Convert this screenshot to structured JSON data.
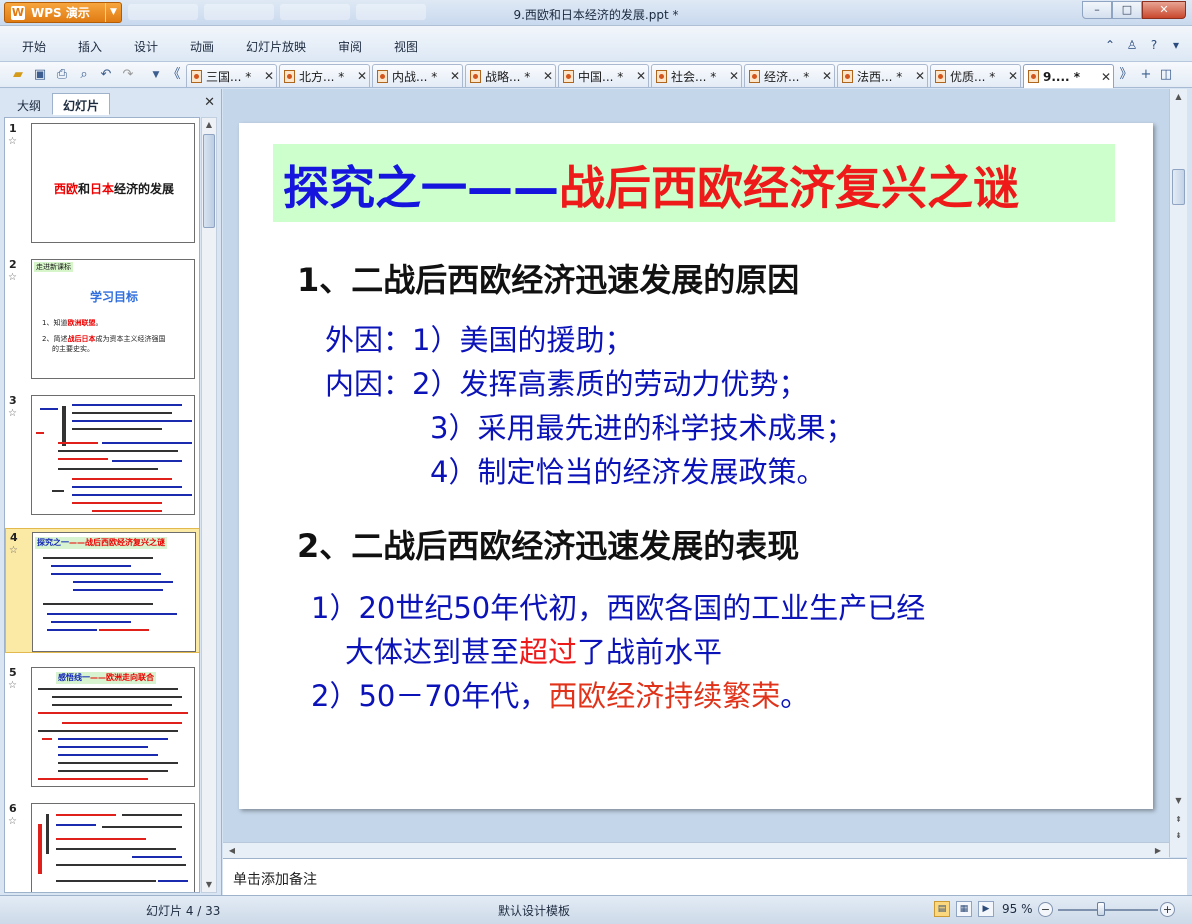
{
  "app": {
    "wps_button": "WPS 演示",
    "doc_title": "9.西欧和日本经济的发展.ppt *"
  },
  "menu": [
    "开始",
    "插入",
    "设计",
    "动画",
    "幻灯片放映",
    "审阅",
    "视图"
  ],
  "doc_tabs": [
    "三国... *",
    "北方... *",
    "内战... *",
    "战略... *",
    "中国... *",
    "社会... *",
    "经济... *",
    "法西... *",
    "优质... *",
    "9.... *"
  ],
  "left_pane": {
    "tabs": [
      "大纲",
      "幻灯片"
    ],
    "slide1": {
      "num": "1",
      "title_a": "西欧",
      "title_b": "和",
      "title_c": "日本",
      "title_d": "经济的发展"
    },
    "slide2": {
      "num": "2",
      "tag": "走进新课标",
      "head": "学习目标",
      "line1a": "1、知道",
      "line1b": "欧洲联盟",
      "line1c": "。",
      "line2a": "2、简述",
      "line2b": "战后日本",
      "line2c": "成为资本主义经济强国",
      "line3": "的主要史实。"
    },
    "slide3": {
      "num": "3"
    },
    "slide4": {
      "num": "4",
      "banner_a": "探究之一",
      "banner_b": "——战后西欧经济复兴之谜"
    },
    "slide5": {
      "num": "5",
      "banner_a": "感悟线一",
      "banner_b": "——欧洲走向联合"
    },
    "slide6": {
      "num": "6"
    }
  },
  "slide": {
    "title_blue": "探究之一——",
    "title_red": "战后西欧经济复兴之谜",
    "h1": "1、二战后西欧经济迅速发展的原因",
    "l1": "外因：1）美国的援助；",
    "l2": "内因：2）发挥高素质的劳动力优势；",
    "l3": "3）采用最先进的科学技术成果；",
    "l4": "4）制定恰当的经济发展政策。",
    "h2": "2、二战后西欧经济迅速发展的表现",
    "l5": "1）20世纪50年代初，西欧各国的工业生产已经",
    "l6a": "大体达到甚至",
    "l6b": "超过",
    "l6c": "了战前水平",
    "l7a": "2）50－70年代，",
    "l7b": "西欧经济持续繁荣",
    "l7c": "。"
  },
  "notes_placeholder": "单击添加备注",
  "status": {
    "slide_pos": "幻灯片 4 / 33",
    "template": "默认设计模板",
    "zoom": "95 %"
  }
}
